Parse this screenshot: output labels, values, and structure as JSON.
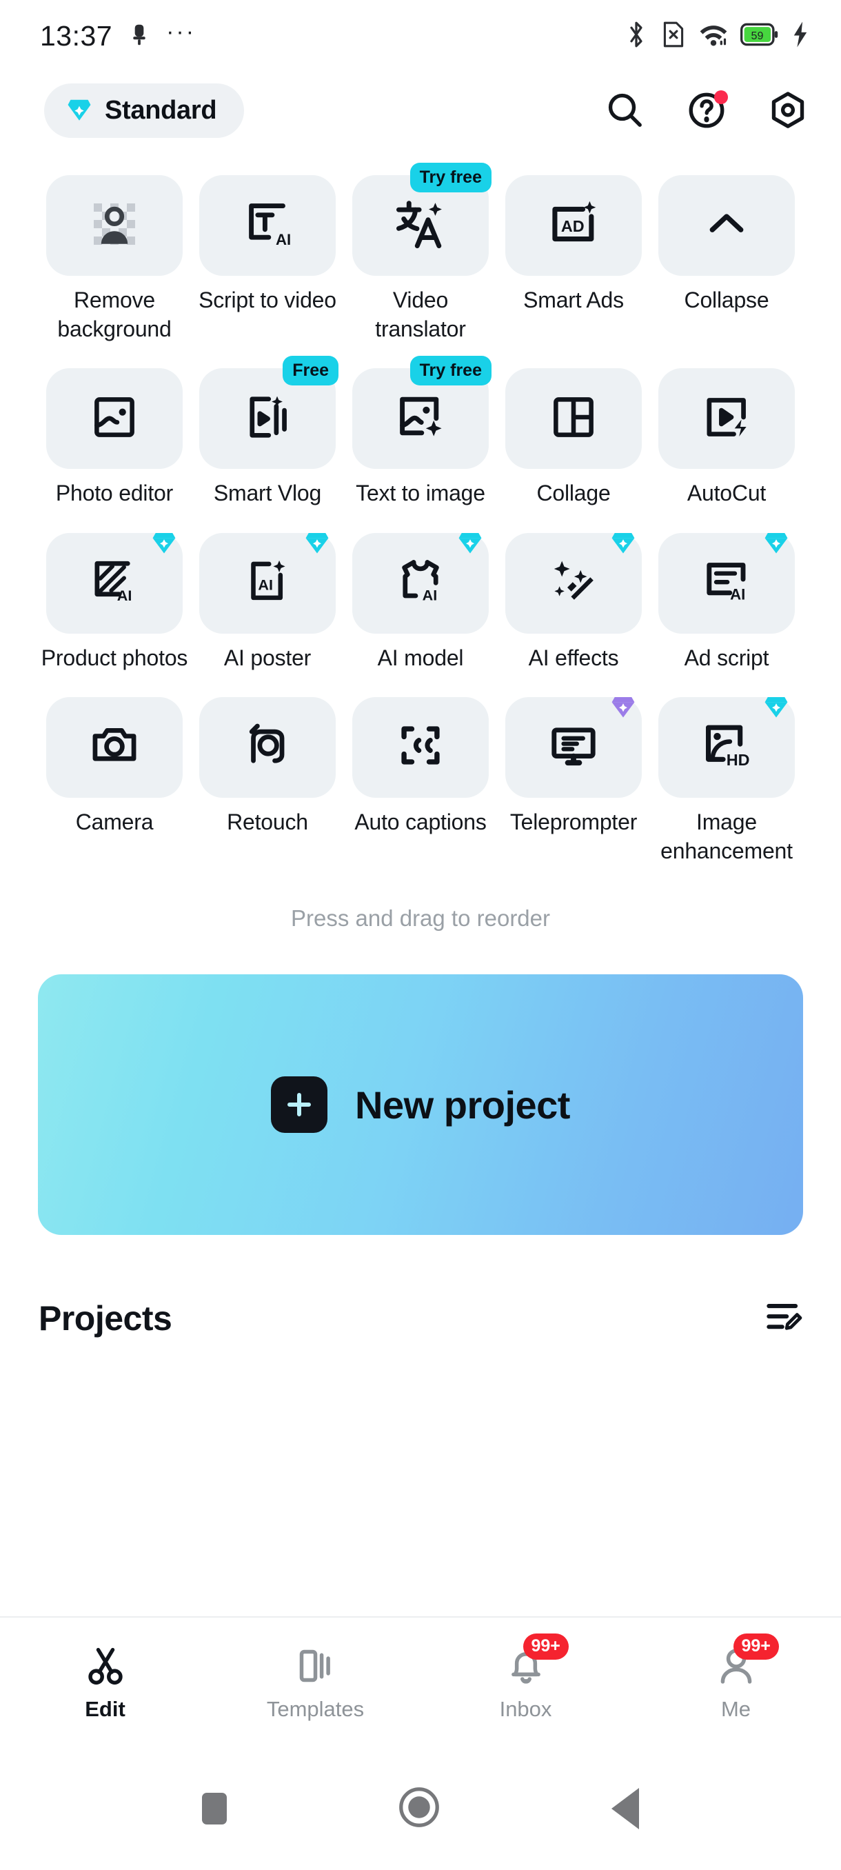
{
  "status_bar": {
    "time": "13:37",
    "left_icons": [
      "notification-icon",
      "more-dots"
    ],
    "overflow": "···",
    "right_icons": [
      "bluetooth-icon",
      "sim-card-off-icon",
      "wifi-icon",
      "battery-icon",
      "charging-bolt-icon"
    ],
    "battery_level": "59"
  },
  "header": {
    "plan_label": "Standard",
    "plan_icon": "diamond-icon",
    "plan_icon_color": "#19d1e8",
    "actions": [
      {
        "name": "search-icon",
        "has_dot": false
      },
      {
        "name": "help-icon",
        "has_dot": true
      },
      {
        "name": "settings-icon",
        "has_dot": false
      }
    ],
    "notification_dot_color": "#fb2b4e"
  },
  "tools": {
    "reorder_hint": "Press and drag to reorder",
    "items": [
      {
        "label": "Remove background",
        "icon": "remove-background-icon",
        "badge": null,
        "gem": null
      },
      {
        "label": "Script to video",
        "icon": "script-to-video-icon",
        "badge": null,
        "gem": null
      },
      {
        "label": "Video translator",
        "icon": "video-translator-icon",
        "badge": "Try free",
        "gem": null
      },
      {
        "label": "Smart Ads",
        "icon": "smart-ads-icon",
        "badge": null,
        "gem": null
      },
      {
        "label": "Collapse",
        "icon": "chevron-up-icon",
        "badge": null,
        "gem": null
      },
      {
        "label": "Photo editor",
        "icon": "photo-editor-icon",
        "badge": null,
        "gem": null
      },
      {
        "label": "Smart Vlog",
        "icon": "smart-vlog-icon",
        "badge": "Free",
        "gem": null
      },
      {
        "label": "Text to image",
        "icon": "text-to-image-icon",
        "badge": "Try free",
        "gem": null
      },
      {
        "label": "Collage",
        "icon": "collage-icon",
        "badge": null,
        "gem": null
      },
      {
        "label": "AutoCut",
        "icon": "autocut-icon",
        "badge": null,
        "gem": null
      },
      {
        "label": "Product photos",
        "icon": "product-photos-icon",
        "badge": null,
        "gem": "cyan"
      },
      {
        "label": "AI poster",
        "icon": "ai-poster-icon",
        "badge": null,
        "gem": "cyan"
      },
      {
        "label": "AI model",
        "icon": "ai-model-icon",
        "badge": null,
        "gem": "cyan"
      },
      {
        "label": "AI effects",
        "icon": "ai-effects-icon",
        "badge": null,
        "gem": "cyan"
      },
      {
        "label": "Ad script",
        "icon": "ad-script-icon",
        "badge": null,
        "gem": "cyan"
      },
      {
        "label": "Camera",
        "icon": "camera-icon",
        "badge": null,
        "gem": null
      },
      {
        "label": "Retouch",
        "icon": "retouch-icon",
        "badge": null,
        "gem": null
      },
      {
        "label": "Auto captions",
        "icon": "auto-captions-icon",
        "badge": null,
        "gem": null
      },
      {
        "label": "Teleprompter",
        "icon": "teleprompter-icon",
        "badge": null,
        "gem": "purple"
      },
      {
        "label": "Image enhancement",
        "icon": "image-enhancement-icon",
        "badge": null,
        "gem": "cyan"
      }
    ],
    "badge_color": "#19d1e8",
    "gem_cyan": "#19d1e8",
    "gem_purple": "#9b7ce8"
  },
  "new_project": {
    "label": "New project",
    "icon": "plus-icon",
    "gradient_from": "#8fe8f0",
    "gradient_to": "#76aff2"
  },
  "projects": {
    "title": "Projects",
    "action_icon": "edit-list-icon"
  },
  "bottom_nav": {
    "items": [
      {
        "label": "Edit",
        "icon": "scissors-icon",
        "active": true,
        "badge": null
      },
      {
        "label": "Templates",
        "icon": "templates-icon",
        "active": false,
        "badge": null
      },
      {
        "label": "Inbox",
        "icon": "bell-icon",
        "active": false,
        "badge": "99+"
      },
      {
        "label": "Me",
        "icon": "person-icon",
        "active": false,
        "badge": "99+"
      }
    ],
    "badge_color": "#f5232f"
  },
  "system_nav": {
    "buttons": [
      "recents-square",
      "home-circle",
      "back-triangle"
    ]
  }
}
